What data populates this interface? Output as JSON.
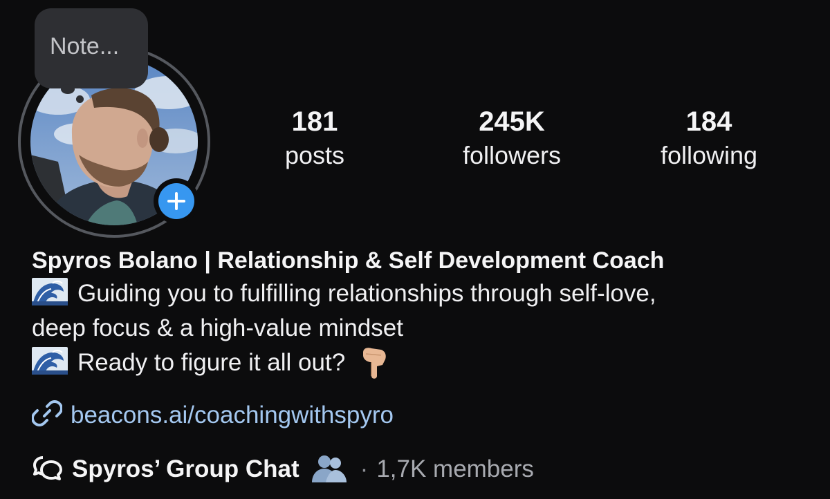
{
  "note": {
    "placeholder": "Note..."
  },
  "avatar": {
    "icon": "profile-photo",
    "add_icon": "plus-icon",
    "add_color": "#3797f0"
  },
  "stats": [
    {
      "value": "181",
      "label": "posts"
    },
    {
      "value": "245K",
      "label": "followers"
    },
    {
      "value": "184",
      "label": "following"
    }
  ],
  "profile": {
    "name": "Spyros Bolano | Relationship & Self Development Coach",
    "bio": {
      "line1": "Guiding you to fulfilling relationships through self-love,",
      "line2": "deep focus & a high-value mindset",
      "line3": "Ready to figure it all out?",
      "wave_emoji": "wave-emoji",
      "point_emoji": "pointing-down-emoji"
    },
    "link": {
      "text": "beacons.ai/coachingwithspyro",
      "color": "#a4c8f0",
      "icon": "link-icon"
    },
    "group_chat": {
      "name": "Spyros’ Group Chat",
      "separator": "·",
      "members": "1,7K members",
      "icon": "chat-bubbles-icon",
      "members_icon": "people-icon"
    }
  }
}
